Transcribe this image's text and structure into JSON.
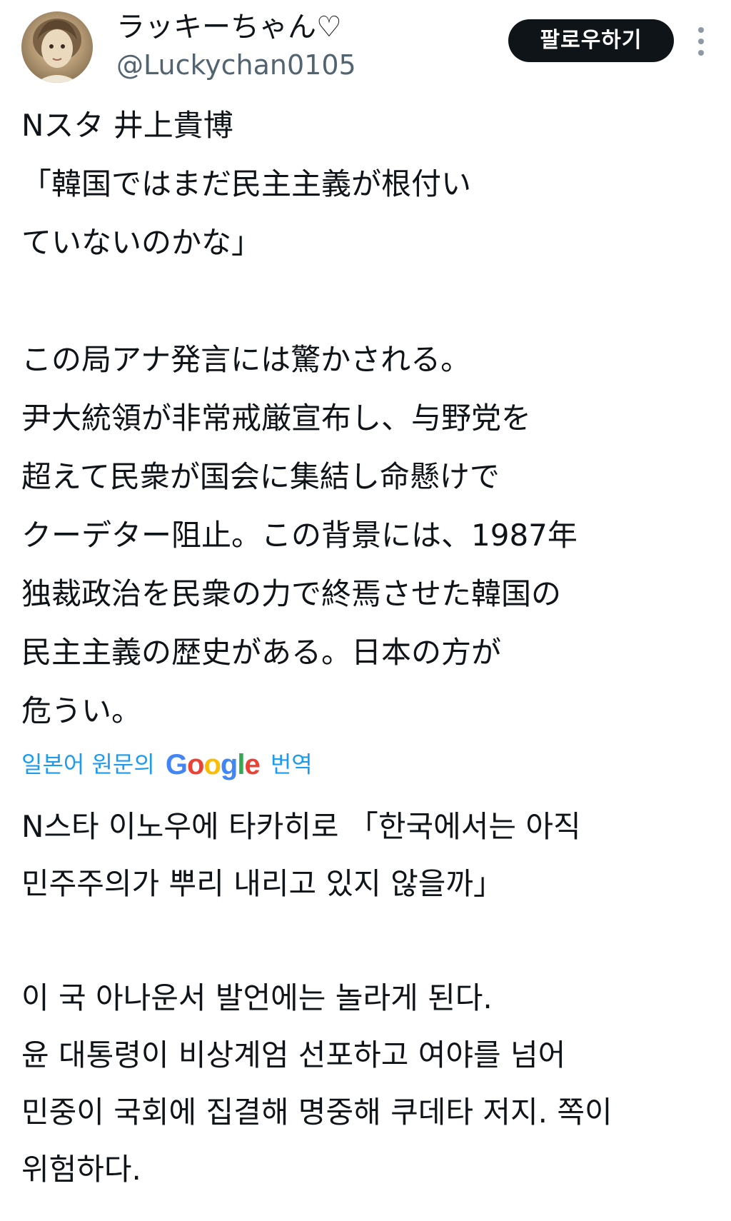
{
  "author": {
    "display_name": "ラッキーちゃん♡",
    "handle": "@Luckychan0105",
    "avatar_icon": "profile-photo"
  },
  "follow_button": {
    "label": "팔로우하기"
  },
  "more_icon": "more-vertical-icon",
  "tweet": {
    "lines": [
      "Nスタ 井上貴博",
      "「韓国ではまだ民主主義が根付い",
      "ていないのかな」",
      "",
      "この局アナ発言には驚かされる。",
      "尹大統領が非常戒厳宣布し、与野党を",
      "超えて民衆が国会に集結し命懸けで",
      "クーデター阻止。この背景には、1987年",
      "独裁政治を民衆の力で終焉させた韓国の",
      "民主主義の歴史がある。日本の方が",
      "危うい。"
    ]
  },
  "translation": {
    "prefix": "일본어 원문의",
    "logo": "Google",
    "suffix": "번역",
    "logo_colors": [
      "#4285F4",
      "#EA4335",
      "#FBBC05",
      "#4285F4",
      "#34A853",
      "#EA4335"
    ],
    "lines": [
      "N스타 이노우에 타카히로 「한국에서는 아직",
      "민주주의가 뿌리 내리고 있지 않을까」",
      "",
      "이 국 아나운서 발언에는 놀라게 된다.",
      "윤 대통령이 비상계엄 선포하고 여야를 넘어",
      "민중이 국회에 집결해 명중해 쿠데타 저지. 쪽이",
      "위험하다."
    ]
  }
}
